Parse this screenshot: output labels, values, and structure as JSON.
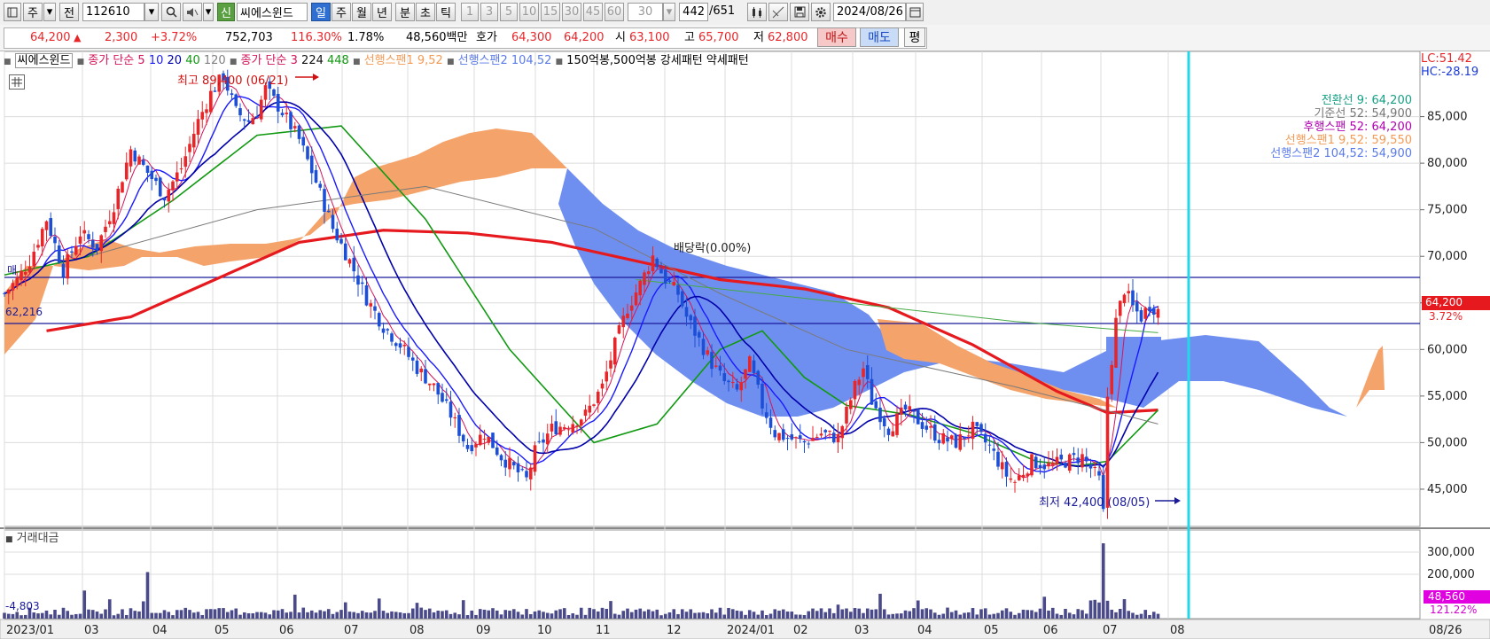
{
  "toolbar": {
    "type_label": "주",
    "prev_label": "전",
    "stock_code": "112610",
    "new_badge": "신",
    "stock_name": "씨에스윈드",
    "periods": [
      "일",
      "주",
      "월",
      "년",
      "분",
      "초",
      "틱"
    ],
    "active_period": "일",
    "intervals": [
      "1",
      "3",
      "5",
      "10",
      "15",
      "30",
      "45",
      "60"
    ],
    "interval_select": "30",
    "count_current": "442",
    "count_total": "/651",
    "date": "2024/08/26"
  },
  "quote": {
    "price": "64,200",
    "change_arrow": "▲",
    "change": "2,300",
    "change_pct": "+3.72%",
    "volume": "752,703",
    "volume_ratio": "116.30%",
    "turnover_ratio": "1.78%",
    "amount": "48,560백만",
    "bid_label": "호가",
    "ask_price": "64,300",
    "bid_price": "64,200",
    "open_label": "시",
    "open": "63,100",
    "high_label": "고",
    "high": "65,700",
    "low_label": "저",
    "low": "62,800",
    "buy_label": "매수",
    "sell_label": "매도",
    "eval_label": "평"
  },
  "legend": {
    "name": "씨에스윈드",
    "ma_label": "종가 단순",
    "ma_periods": [
      "5",
      "10",
      "20",
      "40",
      "120"
    ],
    "ma_colors": [
      "#d4145a",
      "#1a1aff",
      "#0000aa",
      "#119911",
      "#808080"
    ],
    "ma2_label": "종가 단순",
    "ma2_periods": [
      "3",
      "224",
      "448"
    ],
    "span1_label": "선행스팬1 9,52",
    "span2_label": "선행스팬2 104,52",
    "pattern_label": "150억봉,500억봉 강세패턴",
    "weak_label": "약세패턴"
  },
  "corner": {
    "lc": "LC:51.42",
    "hc": "HC:-28.19"
  },
  "ichimoku_readout": [
    {
      "label": "전환선 9: 64,200",
      "color": "#16a085"
    },
    {
      "label": "기준선 52: 54,900",
      "color": "#777777"
    },
    {
      "label": "후행스팬 52: 64,200",
      "color": "#b000b0"
    },
    {
      "label": "선행스팬1 9,52: 59,550",
      "color": "#f39a55"
    },
    {
      "label": "선행스팬2 104,52: 54,900",
      "color": "#5b7be8"
    }
  ],
  "annotations": {
    "high": "최고 89,400 (06/21)",
    "low": "최저 42,400 (08/05)",
    "dividend": "배당락(0.00%)",
    "level_label": "62,216",
    "left_mark": "매",
    "current_price": "64,200",
    "current_pct": "3.72%"
  },
  "volume_panel": {
    "title": "거래대금",
    "current_value": "48,560",
    "current_pct": "121.22%",
    "left_value": "-4,803"
  },
  "chart_data": {
    "type": "candlestick",
    "price_axis": {
      "ticks": [
        45000,
        50000,
        55000,
        60000,
        65000,
        70000,
        75000,
        80000,
        85000
      ],
      "labels": [
        "45,000",
        "50,000",
        "55,000",
        "60,000",
        "65,000",
        "70,000",
        "75,000",
        "80,000",
        "85,000"
      ],
      "range": [
        41000,
        92000
      ]
    },
    "volume_axis": {
      "ticks": [
        200000,
        300000
      ],
      "labels": [
        "200,000",
        "300,000"
      ],
      "range": [
        0,
        400000
      ]
    },
    "x_axis": {
      "labels": [
        "2023/01",
        "03",
        "04",
        "05",
        "06",
        "07",
        "08",
        "09",
        "10",
        "11",
        "12",
        "2024/01",
        "02",
        "03",
        "04",
        "05",
        "06",
        "07",
        "08"
      ],
      "right_label": "08/26"
    },
    "price_path": [
      [
        0,
        66000
      ],
      [
        3,
        67500
      ],
      [
        6,
        69500
      ],
      [
        10,
        74000
      ],
      [
        14,
        68500
      ],
      [
        18,
        72500
      ],
      [
        22,
        71000
      ],
      [
        26,
        75500
      ],
      [
        30,
        81500
      ],
      [
        34,
        79000
      ],
      [
        38,
        76500
      ],
      [
        42,
        79500
      ],
      [
        46,
        84500
      ],
      [
        49,
        87500
      ],
      [
        52,
        89400
      ],
      [
        55,
        85500
      ],
      [
        58,
        84500
      ],
      [
        60,
        85500
      ],
      [
        62,
        88000
      ],
      [
        66,
        85500
      ],
      [
        70,
        82500
      ],
      [
        74,
        78000
      ],
      [
        78,
        73000
      ],
      [
        82,
        69500
      ],
      [
        86,
        65500
      ],
      [
        90,
        62500
      ],
      [
        94,
        60500
      ],
      [
        98,
        58000
      ],
      [
        102,
        56000
      ],
      [
        106,
        53000
      ],
      [
        110,
        49500
      ],
      [
        114,
        51000
      ],
      [
        118,
        48500
      ],
      [
        122,
        46800
      ],
      [
        124,
        46000
      ],
      [
        126,
        49000
      ],
      [
        130,
        51500
      ],
      [
        134,
        52000
      ],
      [
        138,
        53000
      ],
      [
        142,
        56000
      ],
      [
        145,
        60500
      ],
      [
        148,
        64500
      ],
      [
        151,
        67000
      ],
      [
        154,
        70000
      ],
      [
        157,
        67500
      ],
      [
        160,
        66000
      ],
      [
        162,
        63500
      ],
      [
        165,
        61000
      ],
      [
        168,
        58500
      ],
      [
        171,
        56500
      ],
      [
        174,
        55500
      ],
      [
        177,
        58500
      ],
      [
        180,
        54000
      ],
      [
        183,
        51000
      ],
      [
        186,
        50500
      ],
      [
        190,
        50000
      ],
      [
        194,
        51000
      ],
      [
        198,
        50500
      ],
      [
        202,
        56000
      ],
      [
        204,
        58000
      ],
      [
        206,
        54500
      ],
      [
        210,
        51500
      ],
      [
        214,
        53500
      ],
      [
        218,
        52000
      ],
      [
        222,
        50500
      ],
      [
        226,
        50000
      ],
      [
        230,
        51500
      ],
      [
        234,
        49500
      ],
      [
        238,
        46500
      ],
      [
        240,
        45800
      ],
      [
        244,
        48000
      ],
      [
        248,
        47500
      ],
      [
        252,
        48000
      ],
      [
        256,
        48500
      ],
      [
        260,
        46000
      ],
      [
        261,
        42400
      ],
      [
        262,
        55000
      ],
      [
        264,
        63000
      ],
      [
        266,
        66500
      ],
      [
        268,
        64500
      ],
      [
        270,
        63500
      ],
      [
        272,
        64800
      ],
      [
        274,
        64200
      ]
    ],
    "ma_red": [
      [
        10,
        62000
      ],
      [
        30,
        63500
      ],
      [
        50,
        67500
      ],
      [
        70,
        71500
      ],
      [
        90,
        72800
      ],
      [
        110,
        72500
      ],
      [
        130,
        71500
      ],
      [
        150,
        69500
      ],
      [
        170,
        67500
      ],
      [
        190,
        66500
      ],
      [
        210,
        64500
      ],
      [
        230,
        60500
      ],
      [
        250,
        55500
      ],
      [
        262,
        53200
      ],
      [
        274,
        53500
      ]
    ],
    "ma_green": [
      [
        0,
        68000
      ],
      [
        20,
        70000
      ],
      [
        40,
        76000
      ],
      [
        60,
        83000
      ],
      [
        80,
        84000
      ],
      [
        100,
        74000
      ],
      [
        120,
        60000
      ],
      [
        140,
        50000
      ],
      [
        155,
        52000
      ],
      [
        170,
        60000
      ],
      [
        180,
        62000
      ],
      [
        190,
        57000
      ],
      [
        200,
        54000
      ],
      [
        215,
        53000
      ],
      [
        230,
        51000
      ],
      [
        245,
        48000
      ],
      [
        255,
        47500
      ],
      [
        262,
        48000
      ],
      [
        274,
        53500
      ]
    ],
    "volume_peak": {
      "date_index": 261,
      "value": 340000
    }
  }
}
